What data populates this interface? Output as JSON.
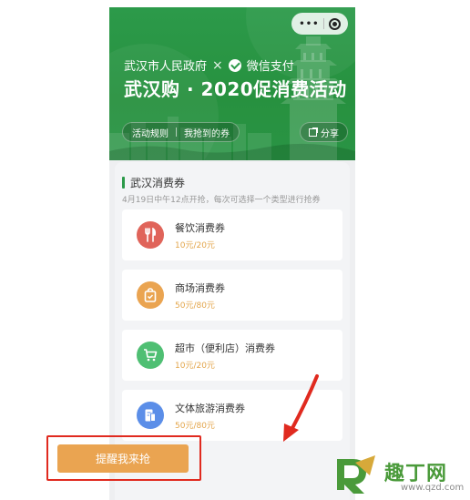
{
  "header": {
    "org_line": "武汉市人民政府",
    "times": "×",
    "pay_label": "微信支付",
    "title": "武汉购 · 2020促消费活动",
    "rules_label": "活动规则",
    "my_coupons_label": "我抢到的券",
    "share_label": "分享",
    "capsule_more": "•••"
  },
  "section": {
    "title": "武汉消费券",
    "subtitle": "4月19日中午12点开抢，每次可选择一个类型进行抢券"
  },
  "coupons": [
    {
      "name": "餐饮消费券",
      "price": "10元/20元",
      "icon": "dining-icon",
      "color": "#e0645a"
    },
    {
      "name": "商场消费券",
      "price": "50元/80元",
      "icon": "shopping-bag-icon",
      "color": "#eaa451"
    },
    {
      "name": "超市（便利店）消费券",
      "price": "10元/20元",
      "icon": "cart-icon",
      "color": "#4fbf73"
    },
    {
      "name": "文体旅游消费券",
      "price": "50元/80元",
      "icon": "ticket-icon",
      "color": "#5b8ee8"
    }
  ],
  "action": {
    "remind_label": "提醒我来抢"
  },
  "watermark": {
    "brand": "趣丁网",
    "url": "www.qzd.com"
  },
  "colors": {
    "brand_green": "#2c9a4a",
    "button_orange": "#eaa451",
    "highlight_red": "#e02a1f"
  }
}
